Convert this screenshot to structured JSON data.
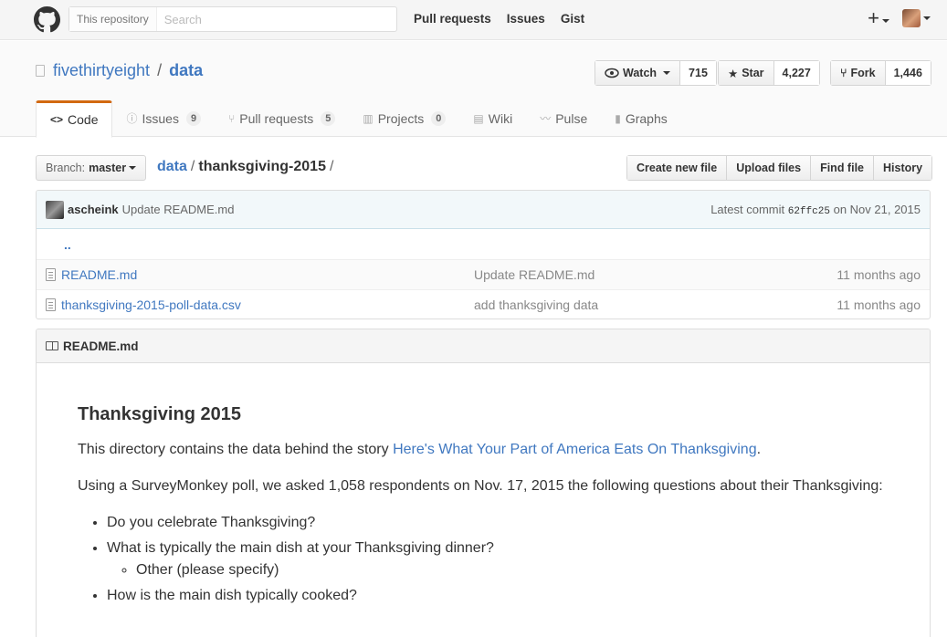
{
  "header": {
    "search_scope": "This repository",
    "search_placeholder": "Search",
    "nav": [
      "Pull requests",
      "Issues",
      "Gist"
    ],
    "plus_label": "+"
  },
  "repo": {
    "owner": "fivethirtyeight",
    "separator": "/",
    "name": "data",
    "watch": {
      "label": "Watch",
      "count": "715"
    },
    "star": {
      "label": "Star",
      "count": "4,227"
    },
    "fork": {
      "label": "Fork",
      "count": "1,446"
    }
  },
  "tabs": [
    {
      "icon": "code-icon",
      "glyph": "<>",
      "label": "Code",
      "counter": ""
    },
    {
      "icon": "issue-icon",
      "glyph": "ⓘ",
      "label": "Issues",
      "counter": "9"
    },
    {
      "icon": "pull-request-icon",
      "glyph": "⑂",
      "label": "Pull requests",
      "counter": "5"
    },
    {
      "icon": "project-icon",
      "glyph": "▥",
      "label": "Projects",
      "counter": "0"
    },
    {
      "icon": "wiki-icon",
      "glyph": "▤",
      "label": "Wiki",
      "counter": ""
    },
    {
      "icon": "pulse-icon",
      "glyph": "〰",
      "label": "Pulse",
      "counter": ""
    },
    {
      "icon": "graph-icon",
      "glyph": "▮",
      "label": "Graphs",
      "counter": ""
    }
  ],
  "filenav": {
    "branch_label": "Branch:",
    "branch_value": "master",
    "breadcrumb_root": "data",
    "breadcrumb_sep": "/",
    "breadcrumb_current": "thanksgiving-2015",
    "breadcrumb_trailing": "/",
    "buttons": [
      "Create new file",
      "Upload files",
      "Find file",
      "History"
    ]
  },
  "commit": {
    "author": "ascheink",
    "message": "Update README.md",
    "latest_label": "Latest commit",
    "sha": "62ffc25",
    "date": "on Nov 21, 2015"
  },
  "files": {
    "up": "..",
    "rows": [
      {
        "name": "README.md",
        "message": "Update README.md",
        "age": "11 months ago"
      },
      {
        "name": "thanksgiving-2015-poll-data.csv",
        "message": "add thanksgiving data",
        "age": "11 months ago"
      }
    ]
  },
  "readme": {
    "filename": "README.md",
    "title": "Thanksgiving 2015",
    "intro_before": "This directory contains the data behind the story ",
    "intro_link": "Here's What Your Part of America Eats On Thanksgiving",
    "intro_after": ".",
    "paragraph2": "Using a SurveyMonkey poll, we asked 1,058 respondents on Nov. 17, 2015 the following questions about their Thanksgiving:",
    "questions": [
      {
        "text": "Do you celebrate Thanksgiving?",
        "sub": []
      },
      {
        "text": "What is typically the main dish at your Thanksgiving dinner?",
        "sub": [
          "Other (please specify)"
        ]
      },
      {
        "text": "How is the main dish typically cooked?",
        "sub": []
      }
    ]
  }
}
